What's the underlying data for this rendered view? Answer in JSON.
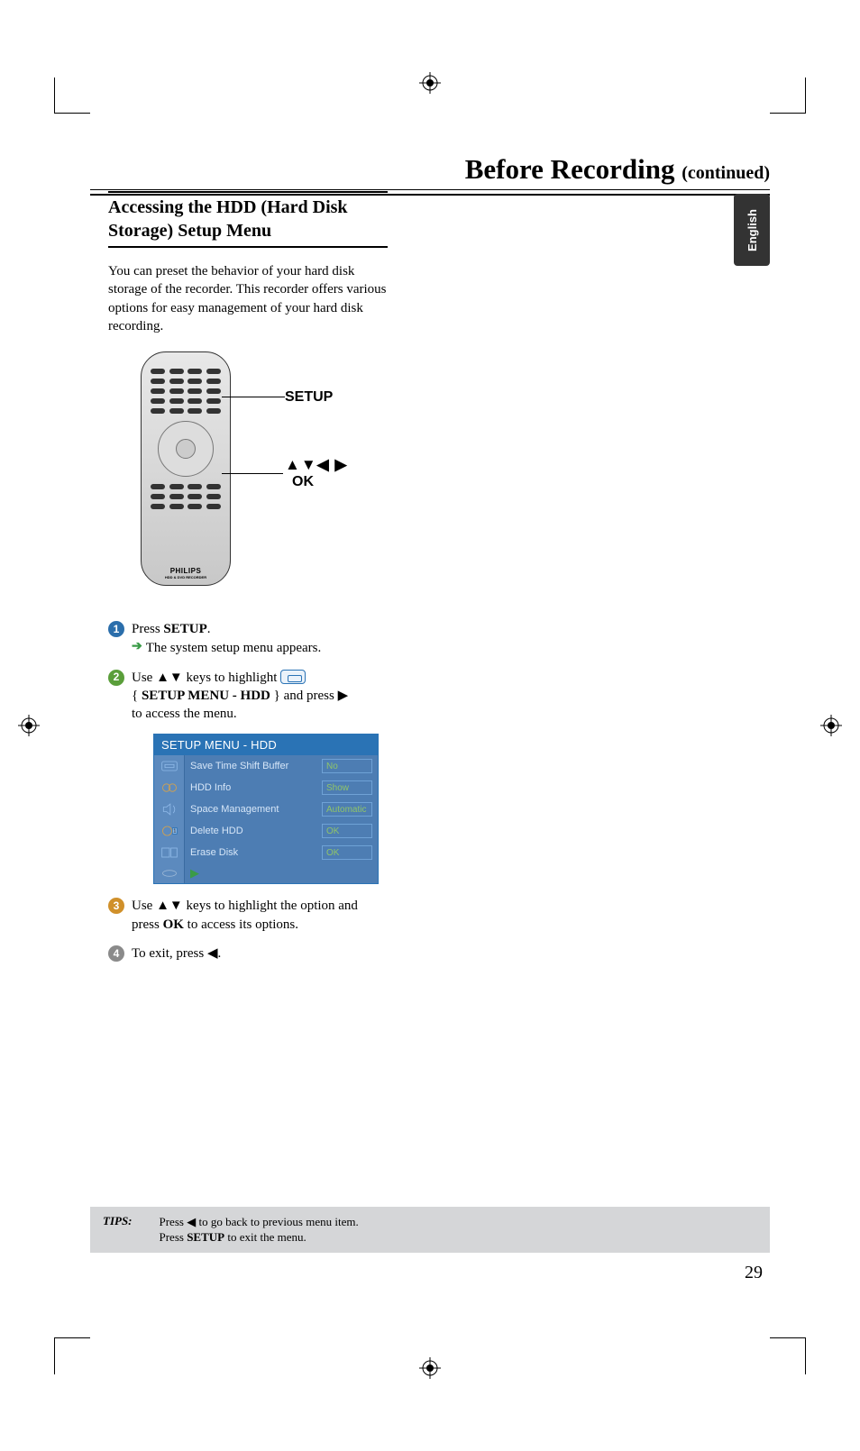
{
  "page": {
    "section_title_main": "Before Recording ",
    "section_title_suffix": "(continued)",
    "language_tab": "English",
    "page_number": "29"
  },
  "subheading": "Accessing the  HDD (Hard Disk Storage) Setup Menu",
  "intro_paragraph": "You can preset the behavior of your hard disk storage of the recorder.  This recorder offers various options for easy management of your hard disk recording.",
  "remote": {
    "label_setup": "SETUP",
    "label_arrows": "▲▼◀ ▶",
    "label_ok": "OK",
    "brand": "PHILIPS",
    "brand_sub": "HDD & DVD RECORDER"
  },
  "steps": {
    "s1_num": "1",
    "s1_text_a": "Press ",
    "s1_setup": "SETUP",
    "s1_text_b": ".",
    "s1_result": "The system setup menu appears.",
    "s2_num": "2",
    "s2_line1_a": "Use ",
    "s2_keys": "▲▼",
    "s2_line1_b": " keys to highlight ",
    "s2_line2_a": "{ ",
    "s2_menu_label": "SETUP MENU - HDD",
    "s2_line2_b": " } and press ",
    "s2_arrow_r": "▶",
    "s2_line3": "to access the menu.",
    "s3_num": "3",
    "s3_a": "Use ",
    "s3_keys": "▲▼",
    "s3_b": " keys to highlight the option and press ",
    "s3_ok": "OK",
    "s3_c": " to access its options.",
    "s4_num": "4",
    "s4_a": "To exit, press ",
    "s4_arrow_l": "◀",
    "s4_b": "."
  },
  "menu": {
    "title": "SETUP MENU - HDD",
    "rows": [
      {
        "label": "Save Time Shift Buffer",
        "value": "No"
      },
      {
        "label": "HDD Info",
        "value": "Show"
      },
      {
        "label": "Space Management",
        "value": "Automatic"
      },
      {
        "label": "Delete HDD",
        "value": "OK"
      },
      {
        "label": "Erase Disk",
        "value": "OK"
      }
    ]
  },
  "tips": {
    "label": "TIPS:",
    "line1_a": "Press ",
    "line1_arrow": "◀",
    "line1_b": " to go back to previous menu item.",
    "line2_a": "Press ",
    "line2_setup": "SETUP",
    "line2_b": " to exit the menu."
  }
}
